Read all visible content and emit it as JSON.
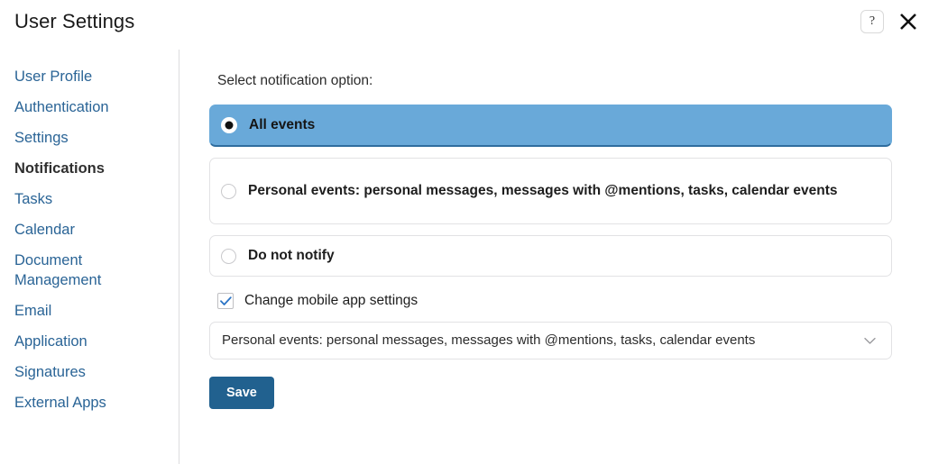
{
  "header": {
    "title": "User Settings",
    "help_icon": "question-mark-icon",
    "help_glyph": "?",
    "close_icon": "close-icon"
  },
  "sidebar": {
    "items": [
      {
        "label": "User Profile",
        "active": false
      },
      {
        "label": "Authentication",
        "active": false
      },
      {
        "label": "Settings",
        "active": false
      },
      {
        "label": "Notifications",
        "active": true
      },
      {
        "label": "Tasks",
        "active": false
      },
      {
        "label": "Calendar",
        "active": false
      },
      {
        "label": "Document Management",
        "active": false
      },
      {
        "label": "Email",
        "active": false
      },
      {
        "label": "Application",
        "active": false
      },
      {
        "label": "Signatures",
        "active": false
      },
      {
        "label": "External Apps",
        "active": false
      }
    ]
  },
  "main": {
    "section_label": "Select notification option:",
    "options": [
      {
        "label": "All events",
        "selected": true
      },
      {
        "label": "Personal events: personal messages, messages with @mentions, tasks, calendar events",
        "selected": false
      },
      {
        "label": "Do not notify",
        "selected": false
      }
    ],
    "checkbox": {
      "label": "Change mobile app settings",
      "checked": true
    },
    "select": {
      "value": "Personal events: personal messages, messages with @mentions, tasks, calendar events",
      "chevron_icon": "chevron-down-icon"
    },
    "save_label": "Save"
  },
  "colors": {
    "accent_blue": "#69a9d9",
    "selected_border": "#2f6d9e",
    "link_blue": "#2a6496",
    "save_blue": "#21618f",
    "check_blue": "#2a73c5",
    "card_border": "#e2e2e4",
    "divider": "#dcdcde"
  }
}
